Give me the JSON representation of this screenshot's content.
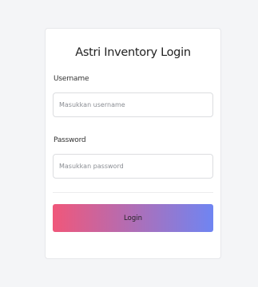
{
  "login": {
    "title": "Astri Inventory Login",
    "username_label": "Username",
    "username_placeholder": "Masukkan username",
    "password_label": "Password",
    "password_placeholder": "Masukkan password",
    "submit_label": "Login"
  },
  "colors": {
    "button_gradient_start": "#f0577a",
    "button_gradient_end": "#6f85f2"
  }
}
